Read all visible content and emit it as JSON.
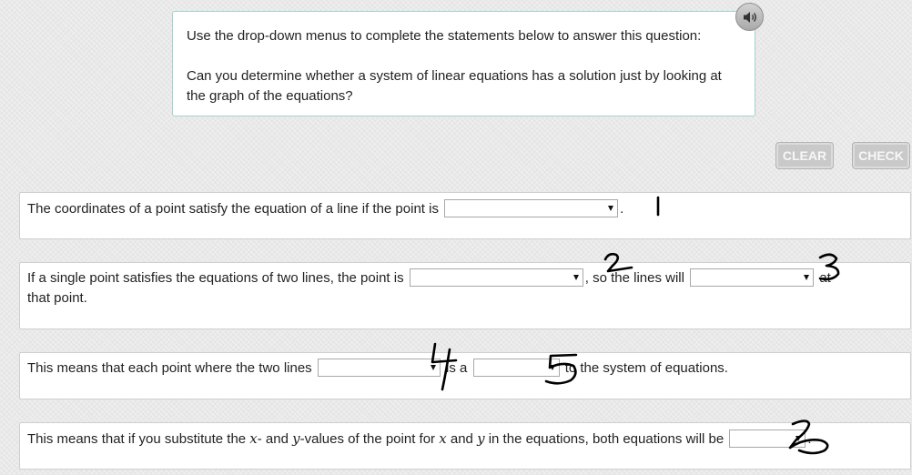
{
  "question": {
    "instruction": "Use the drop-down menus to complete the statements below to answer this question:",
    "prompt": "Can you determine whether a system of linear equations has a solution just by looking at the graph of the equations?"
  },
  "toolbar": {
    "clear_label": "CLEAR",
    "check_label": "CHECK"
  },
  "statements": [
    {
      "before": "The coordinates of a point satisfy the equation of a line if the point is",
      "after": "."
    },
    {
      "before": "If a single point satisfies the equations of two lines, the point is",
      "middle": ", so the lines will",
      "after": "at",
      "line2": "that point."
    },
    {
      "before": "This means that each point where the two lines",
      "middle": "is a",
      "after": "to the system of equations."
    },
    {
      "before": "This means that if you substitute the",
      "var_x": "x",
      "after_x": "- and",
      "var_y": "y",
      "after_y": "-values of the point for",
      "var_x2": "x",
      "and": "and",
      "var_y2": "y",
      "rest": "in the equations, both equations will be",
      "after": "."
    }
  ],
  "annotations": [
    "1",
    "2",
    "3",
    "4",
    "5",
    "6"
  ]
}
